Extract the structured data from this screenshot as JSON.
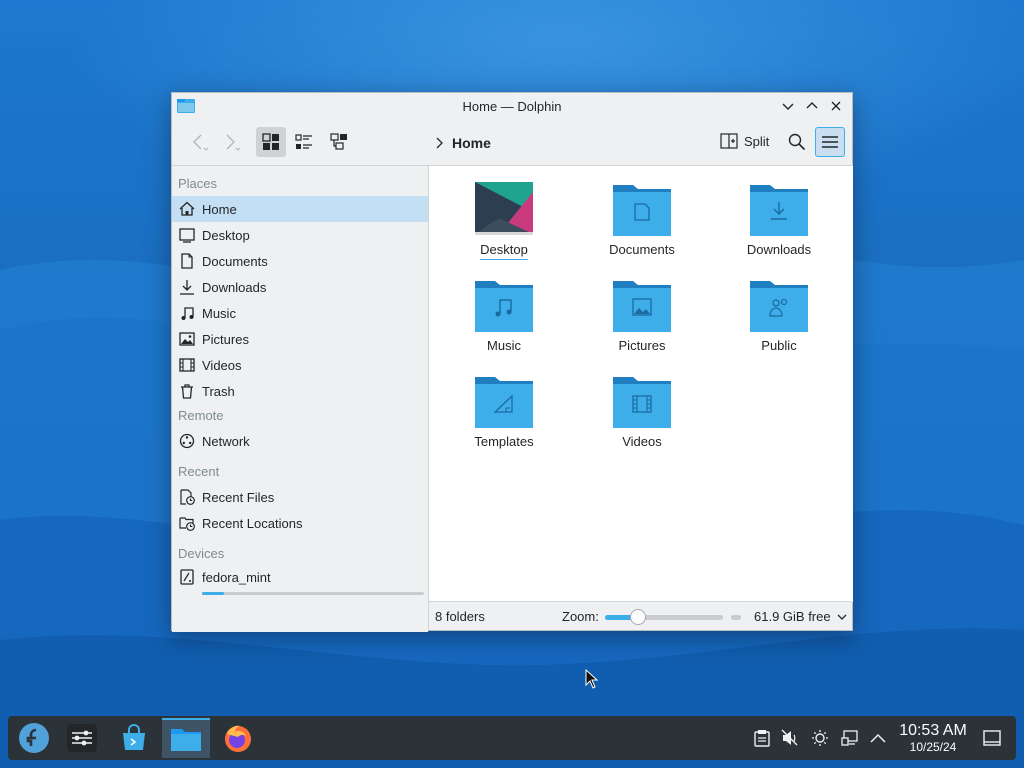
{
  "window": {
    "title": "Home — Dolphin"
  },
  "toolbar": {
    "breadcrumb_current": "Home",
    "split_label": "Split"
  },
  "sidebar": {
    "sections": {
      "places": "Places",
      "remote": "Remote",
      "recent": "Recent",
      "devices": "Devices"
    },
    "places": [
      {
        "label": "Home",
        "icon": "home-icon",
        "selected": true
      },
      {
        "label": "Desktop",
        "icon": "desktop-icon"
      },
      {
        "label": "Documents",
        "icon": "documents-icon"
      },
      {
        "label": "Downloads",
        "icon": "downloads-icon"
      },
      {
        "label": "Music",
        "icon": "music-icon"
      },
      {
        "label": "Pictures",
        "icon": "pictures-icon"
      },
      {
        "label": "Videos",
        "icon": "videos-icon"
      },
      {
        "label": "Trash",
        "icon": "trash-icon"
      }
    ],
    "remote": [
      {
        "label": "Network",
        "icon": "network-icon"
      }
    ],
    "recent": [
      {
        "label": "Recent Files",
        "icon": "recent-files-icon"
      },
      {
        "label": "Recent Locations",
        "icon": "recent-locations-icon"
      }
    ],
    "devices": [
      {
        "label": "fedora_mint",
        "icon": "drive-icon",
        "usage_fraction": 0.1
      }
    ]
  },
  "content": {
    "items": [
      {
        "label": "Desktop",
        "icon": "desktop-folder-icon"
      },
      {
        "label": "Documents",
        "icon": "documents-folder-icon"
      },
      {
        "label": "Downloads",
        "icon": "downloads-folder-icon"
      },
      {
        "label": "Music",
        "icon": "music-folder-icon"
      },
      {
        "label": "Pictures",
        "icon": "pictures-folder-icon"
      },
      {
        "label": "Public",
        "icon": "public-folder-icon"
      },
      {
        "label": "Templates",
        "icon": "templates-folder-icon"
      },
      {
        "label": "Videos",
        "icon": "videos-folder-icon"
      }
    ]
  },
  "statusbar": {
    "folder_count": "8 folders",
    "zoom_label": "Zoom:",
    "zoom_fraction": 0.28,
    "free_space": "61.9 GiB free"
  },
  "taskbar": {
    "time": "10:53 AM",
    "date": "10/25/24"
  },
  "colors": {
    "accent": "#3daee9",
    "folder": "#3daee9",
    "selection": "#c4dff3",
    "taskbar": "#2c3338"
  }
}
